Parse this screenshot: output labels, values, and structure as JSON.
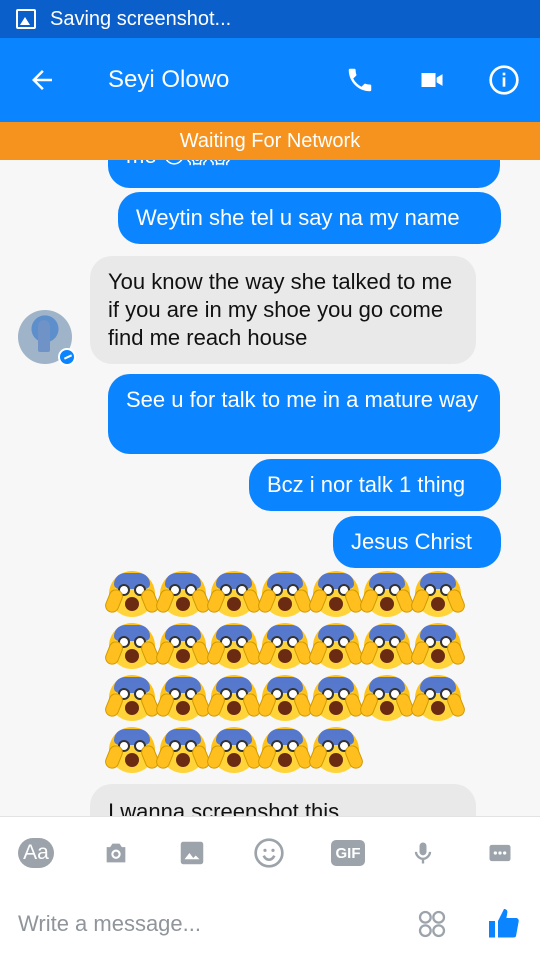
{
  "status_bar": {
    "text": "Saving screenshot..."
  },
  "header": {
    "title": "Seyi Olowo"
  },
  "network_banner": {
    "text": "Waiting For Network"
  },
  "messages": [
    {
      "from": "self",
      "text": "me 😞😱😱"
    },
    {
      "from": "self",
      "text": "Weytin she tel u say na my name"
    },
    {
      "from": "contact",
      "text": "You know the way she talked to me if you are in my shoe you go come find me reach house"
    },
    {
      "from": "self",
      "text": "See u for talk to me in a mature way"
    },
    {
      "from": "self",
      "text": "Bcz i nor talk 1 thing"
    },
    {
      "from": "self",
      "text": "Jesus Christ"
    },
    {
      "from": "self",
      "text": "😱😱😱😱😱😱😱😱😱😱😱😱😱😱😱😱😱😱😱😱😱😱😱😱😱😱"
    },
    {
      "from": "contact",
      "text": "I wanna screenshot this"
    }
  ],
  "composer": {
    "placeholder": "Write a message..."
  },
  "toolbar": {
    "aa_label": "Aa",
    "gif_label": "GIF"
  },
  "colors": {
    "primary": "#0b84ff",
    "statusbar": "#0b5fcb",
    "banner": "#f6921e",
    "incoming_bubble": "#e9e9ea"
  },
  "icons": [
    "image-icon",
    "back-arrow-icon",
    "phone-icon",
    "video-icon",
    "info-icon",
    "camera-icon",
    "gallery-icon",
    "emoji-icon",
    "gif-icon",
    "mic-icon",
    "more-icon",
    "stickers-icon",
    "like-icon"
  ]
}
